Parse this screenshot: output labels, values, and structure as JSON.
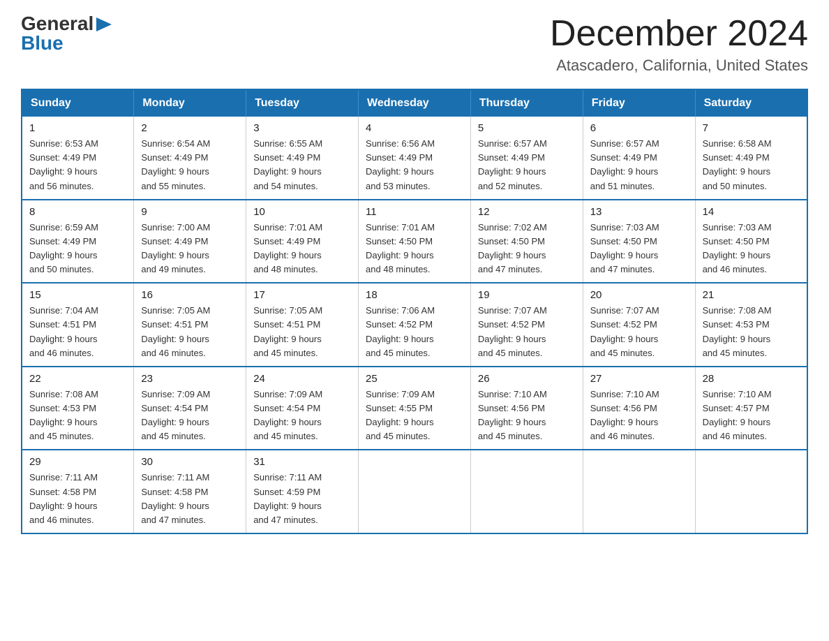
{
  "logo": {
    "general": "General",
    "blue": "Blue"
  },
  "header": {
    "month_year": "December 2024",
    "location": "Atascadero, California, United States"
  },
  "days_of_week": [
    "Sunday",
    "Monday",
    "Tuesday",
    "Wednesday",
    "Thursday",
    "Friday",
    "Saturday"
  ],
  "weeks": [
    [
      {
        "day": "1",
        "sunrise": "6:53 AM",
        "sunset": "4:49 PM",
        "daylight": "9 hours and 56 minutes."
      },
      {
        "day": "2",
        "sunrise": "6:54 AM",
        "sunset": "4:49 PM",
        "daylight": "9 hours and 55 minutes."
      },
      {
        "day": "3",
        "sunrise": "6:55 AM",
        "sunset": "4:49 PM",
        "daylight": "9 hours and 54 minutes."
      },
      {
        "day": "4",
        "sunrise": "6:56 AM",
        "sunset": "4:49 PM",
        "daylight": "9 hours and 53 minutes."
      },
      {
        "day": "5",
        "sunrise": "6:57 AM",
        "sunset": "4:49 PM",
        "daylight": "9 hours and 52 minutes."
      },
      {
        "day": "6",
        "sunrise": "6:57 AM",
        "sunset": "4:49 PM",
        "daylight": "9 hours and 51 minutes."
      },
      {
        "day": "7",
        "sunrise": "6:58 AM",
        "sunset": "4:49 PM",
        "daylight": "9 hours and 50 minutes."
      }
    ],
    [
      {
        "day": "8",
        "sunrise": "6:59 AM",
        "sunset": "4:49 PM",
        "daylight": "9 hours and 50 minutes."
      },
      {
        "day": "9",
        "sunrise": "7:00 AM",
        "sunset": "4:49 PM",
        "daylight": "9 hours and 49 minutes."
      },
      {
        "day": "10",
        "sunrise": "7:01 AM",
        "sunset": "4:49 PM",
        "daylight": "9 hours and 48 minutes."
      },
      {
        "day": "11",
        "sunrise": "7:01 AM",
        "sunset": "4:50 PM",
        "daylight": "9 hours and 48 minutes."
      },
      {
        "day": "12",
        "sunrise": "7:02 AM",
        "sunset": "4:50 PM",
        "daylight": "9 hours and 47 minutes."
      },
      {
        "day": "13",
        "sunrise": "7:03 AM",
        "sunset": "4:50 PM",
        "daylight": "9 hours and 47 minutes."
      },
      {
        "day": "14",
        "sunrise": "7:03 AM",
        "sunset": "4:50 PM",
        "daylight": "9 hours and 46 minutes."
      }
    ],
    [
      {
        "day": "15",
        "sunrise": "7:04 AM",
        "sunset": "4:51 PM",
        "daylight": "9 hours and 46 minutes."
      },
      {
        "day": "16",
        "sunrise": "7:05 AM",
        "sunset": "4:51 PM",
        "daylight": "9 hours and 46 minutes."
      },
      {
        "day": "17",
        "sunrise": "7:05 AM",
        "sunset": "4:51 PM",
        "daylight": "9 hours and 45 minutes."
      },
      {
        "day": "18",
        "sunrise": "7:06 AM",
        "sunset": "4:52 PM",
        "daylight": "9 hours and 45 minutes."
      },
      {
        "day": "19",
        "sunrise": "7:07 AM",
        "sunset": "4:52 PM",
        "daylight": "9 hours and 45 minutes."
      },
      {
        "day": "20",
        "sunrise": "7:07 AM",
        "sunset": "4:52 PM",
        "daylight": "9 hours and 45 minutes."
      },
      {
        "day": "21",
        "sunrise": "7:08 AM",
        "sunset": "4:53 PM",
        "daylight": "9 hours and 45 minutes."
      }
    ],
    [
      {
        "day": "22",
        "sunrise": "7:08 AM",
        "sunset": "4:53 PM",
        "daylight": "9 hours and 45 minutes."
      },
      {
        "day": "23",
        "sunrise": "7:09 AM",
        "sunset": "4:54 PM",
        "daylight": "9 hours and 45 minutes."
      },
      {
        "day": "24",
        "sunrise": "7:09 AM",
        "sunset": "4:54 PM",
        "daylight": "9 hours and 45 minutes."
      },
      {
        "day": "25",
        "sunrise": "7:09 AM",
        "sunset": "4:55 PM",
        "daylight": "9 hours and 45 minutes."
      },
      {
        "day": "26",
        "sunrise": "7:10 AM",
        "sunset": "4:56 PM",
        "daylight": "9 hours and 45 minutes."
      },
      {
        "day": "27",
        "sunrise": "7:10 AM",
        "sunset": "4:56 PM",
        "daylight": "9 hours and 46 minutes."
      },
      {
        "day": "28",
        "sunrise": "7:10 AM",
        "sunset": "4:57 PM",
        "daylight": "9 hours and 46 minutes."
      }
    ],
    [
      {
        "day": "29",
        "sunrise": "7:11 AM",
        "sunset": "4:58 PM",
        "daylight": "9 hours and 46 minutes."
      },
      {
        "day": "30",
        "sunrise": "7:11 AM",
        "sunset": "4:58 PM",
        "daylight": "9 hours and 47 minutes."
      },
      {
        "day": "31",
        "sunrise": "7:11 AM",
        "sunset": "4:59 PM",
        "daylight": "9 hours and 47 minutes."
      },
      null,
      null,
      null,
      null
    ]
  ],
  "labels": {
    "sunrise": "Sunrise:",
    "sunset": "Sunset:",
    "daylight": "Daylight:"
  }
}
